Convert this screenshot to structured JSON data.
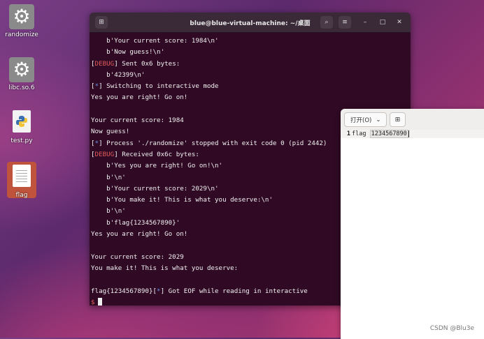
{
  "desktop": {
    "icons": [
      {
        "label": "randomize"
      },
      {
        "label": "libc.so.6"
      },
      {
        "label": "test.py"
      },
      {
        "label": "flag"
      }
    ]
  },
  "terminal": {
    "title": "blue@blue-virtual-machine: ~/桌面",
    "lines": [
      {
        "text": "    b'Your current score: 1984\\n'"
      },
      {
        "text": "    b'Now guess!\\n'"
      },
      {
        "pre": "[",
        "tag": "DEBUG",
        "post": "] Sent 0x6 bytes:"
      },
      {
        "text": "    b'42399\\n'"
      },
      {
        "pre": "[",
        "star": "*",
        "post": "] Switching to interactive mode"
      },
      {
        "text": "Yes you are right! Go on!"
      },
      {
        "text": ""
      },
      {
        "text": "Your current score: 1984"
      },
      {
        "text": "Now guess!"
      },
      {
        "pre": "[",
        "star": "*",
        "post": "] Process './randomize' stopped with exit code 0 (pid 2442)"
      },
      {
        "pre": "[",
        "tag": "DEBUG",
        "post": "] Received 0x6c bytes:"
      },
      {
        "text": "    b'Yes you are right! Go on!\\n'"
      },
      {
        "text": "    b'\\n'"
      },
      {
        "text": "    b'Your current score: 2029\\n'"
      },
      {
        "text": "    b'You make it! This is what you deserve:\\n'"
      },
      {
        "text": "    b'\\n'"
      },
      {
        "text": "    b'flag{1234567890}'"
      },
      {
        "text": "Yes you are right! Go on!"
      },
      {
        "text": ""
      },
      {
        "text": "Your current score: 2029"
      },
      {
        "text": "You make it! This is what you deserve:"
      },
      {
        "text": ""
      },
      {
        "pre": "flag{1234567890}[",
        "star": "*",
        "post": "] Got EOF while reading in interactive"
      },
      {
        "prompt": "$"
      }
    ]
  },
  "editor": {
    "open_label": "打开(O)",
    "line_number": "1",
    "line_text": "flag",
    "line_selected": "1234567890"
  },
  "watermark": "CSDN @Blu3e"
}
